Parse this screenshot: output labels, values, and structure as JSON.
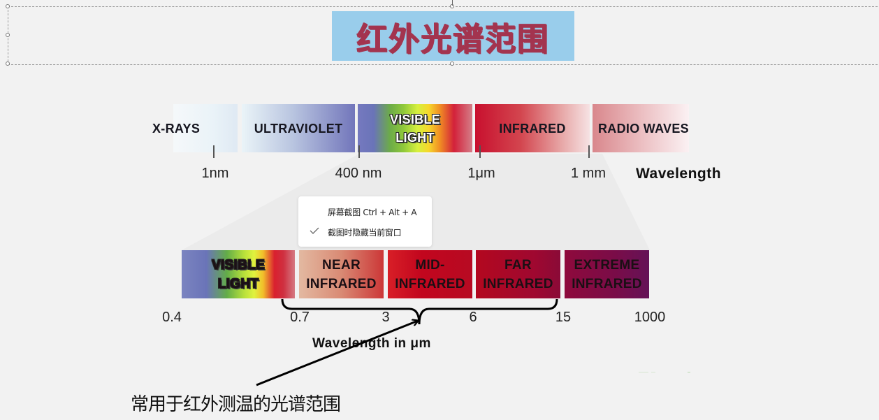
{
  "slide": {
    "title": "红外光谱范围",
    "title_colors": {
      "text": "#a3344f",
      "background": "#99cdeb"
    }
  },
  "spectrum_top": {
    "bands": [
      {
        "label": "X-RAYS"
      },
      {
        "label": "ULTRAVIOLET"
      },
      {
        "label_line1": "VISIBLE",
        "label_line2": "LIGHT"
      },
      {
        "label": "INFRARED"
      },
      {
        "label": "RADIO WAVES"
      }
    ],
    "ticks": [
      "1nm",
      "400 nm",
      "1μm",
      "1 mm"
    ],
    "axis_label": "Wavelength"
  },
  "spectrum_bottom": {
    "bands": [
      {
        "line1": "VISIBLE",
        "line2": "LIGHT"
      },
      {
        "line1": "NEAR",
        "line2": "INFRARED"
      },
      {
        "line1": "MID-",
        "line2": "INFRARED"
      },
      {
        "line1": "FAR",
        "line2": "INFRARED"
      },
      {
        "line1": "EXTREME",
        "line2": "INFRARED"
      }
    ],
    "ticks": [
      "0.4",
      "0.7",
      "3",
      "6",
      "15",
      "1000"
    ],
    "axis_label": "Wavelength in μm",
    "bracket_range": [
      "0.7",
      "15"
    ]
  },
  "annotation": {
    "caption": "常用于红外测温的光谱范围"
  },
  "context_menu": {
    "items": [
      {
        "label": "屏幕截图 Ctrl + Alt + A",
        "checked": false
      },
      {
        "label": "截图时隐藏当前窗口",
        "checked": true
      }
    ]
  }
}
